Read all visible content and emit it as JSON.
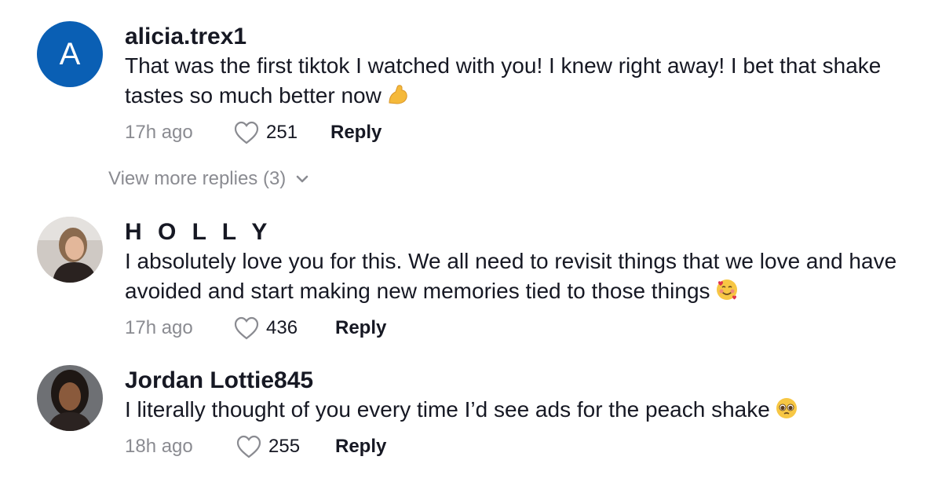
{
  "comments": [
    {
      "avatar_letter": "A",
      "username": "alicia.trex1",
      "text": "That was the first tiktok I watched with you! I knew right away! I bet that shake tastes so much better now",
      "emoji": "flexed-biceps",
      "time": "17h ago",
      "likes": "251",
      "reply_label": "Reply"
    },
    {
      "username": "H O L L Y",
      "text": "I absolutely love you for this. We all need to revisit things that we love and have avoided and start making new memories tied to those things",
      "emoji": "smiling-face-with-hearts",
      "time": "17h ago",
      "likes": "436",
      "reply_label": "Reply"
    },
    {
      "username": "Jordan Lottie845",
      "text": "I literally thought of you every time I’d see ads for the peach shake",
      "emoji": "pleading-face",
      "time": "18h ago",
      "likes": "255",
      "reply_label": "Reply"
    }
  ],
  "view_more": "View more replies (3)",
  "colors": {
    "avatar_blue": "#0a5fb4",
    "muted": "#8a8b91",
    "text": "#161823"
  }
}
